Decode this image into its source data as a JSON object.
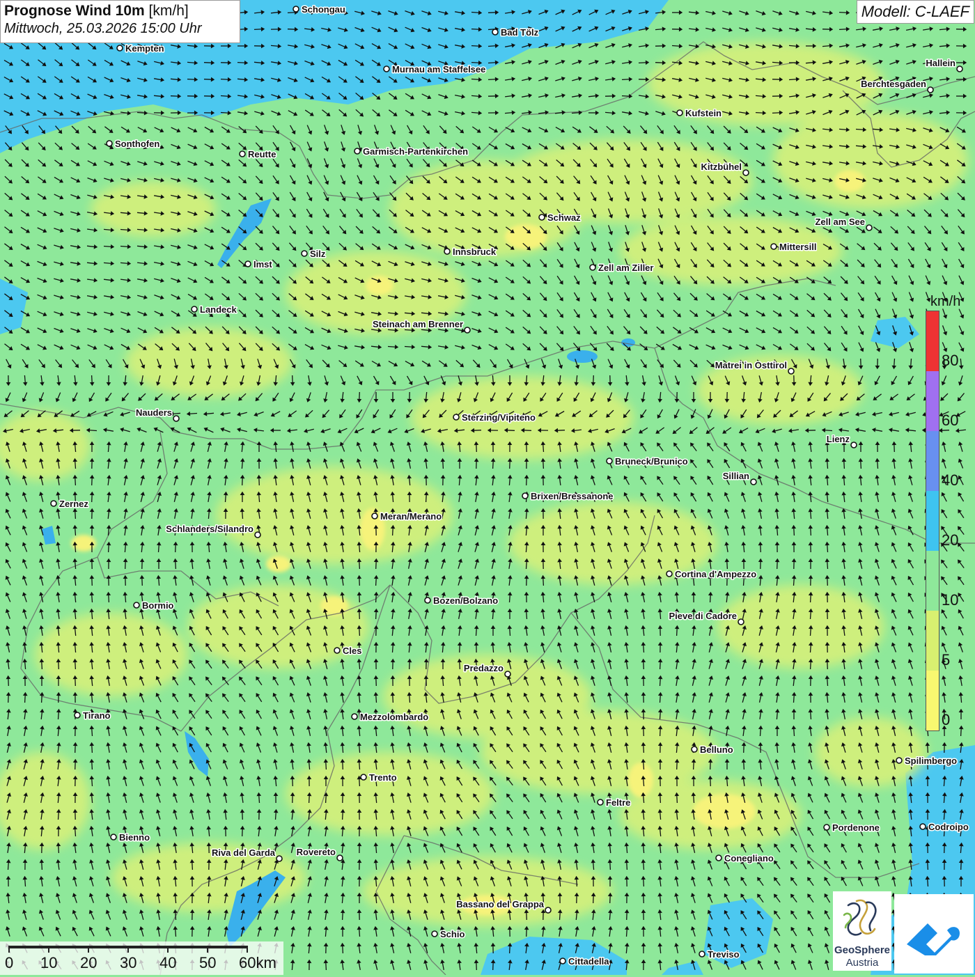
{
  "header": {
    "title_bold": "Prognose Wind 10m",
    "title_unit": "[km/h]",
    "datetime": "Mittwoch, 25.03.2026 15:00 Uhr",
    "model": "Modell: C-LAEF"
  },
  "legend": {
    "unit": "km/h",
    "classes": [
      {
        "label": "80",
        "color": "#ee3333"
      },
      {
        "label": "60",
        "color": "#a070f0"
      },
      {
        "label": "40",
        "color": "#6890f0"
      },
      {
        "label": "20",
        "color": "#3ec4f0"
      },
      {
        "label": "10",
        "color": "#8ee89a"
      },
      {
        "label": "5",
        "color": "#d8f070"
      },
      {
        "label": "0",
        "color": "#f8f870"
      }
    ]
  },
  "scale": {
    "labels": [
      "0",
      "10",
      "20",
      "30",
      "40",
      "50",
      "60km"
    ]
  },
  "branding": {
    "name_line1": "GeoSphere",
    "name_line2": "Austria"
  },
  "cities": [
    {
      "name": "Schongau"
    },
    {
      "name": "Bad Tölz"
    },
    {
      "name": "Kempten"
    },
    {
      "name": "Murnau am Staffelsee"
    },
    {
      "name": "Hallein"
    },
    {
      "name": "Berchtesgaden"
    },
    {
      "name": "Kufstein"
    },
    {
      "name": "Sonthofen"
    },
    {
      "name": "Reutte"
    },
    {
      "name": "Garmisch-Partenkirchen"
    },
    {
      "name": "Kitzbühel"
    },
    {
      "name": "Schwaz"
    },
    {
      "name": "Zell am See"
    },
    {
      "name": "Mittersill"
    },
    {
      "name": "Innsbruck"
    },
    {
      "name": "Silz"
    },
    {
      "name": "Imst"
    },
    {
      "name": "Zell am Ziller"
    },
    {
      "name": "Landeck"
    },
    {
      "name": "Steinach am Brenner"
    },
    {
      "name": "Matrei in Osttirol"
    },
    {
      "name": "Nauders"
    },
    {
      "name": "Sterzing/Vipiteno"
    },
    {
      "name": "Lienz"
    },
    {
      "name": "Bruneck/Brunico"
    },
    {
      "name": "Sillian"
    },
    {
      "name": "Brixen/Bressanone"
    },
    {
      "name": "Zernez"
    },
    {
      "name": "Meran/Merano"
    },
    {
      "name": "Schlanders/Silandro"
    },
    {
      "name": "Cortina d'Ampezzo"
    },
    {
      "name": "Bozen/Bolzano"
    },
    {
      "name": "Bormio"
    },
    {
      "name": "Pieve di Cadore"
    },
    {
      "name": "Cles"
    },
    {
      "name": "Predazzo"
    },
    {
      "name": "Tirano"
    },
    {
      "name": "Mezzolombardo"
    },
    {
      "name": "Belluno"
    },
    {
      "name": "Spilimbergo"
    },
    {
      "name": "Trento"
    },
    {
      "name": "Feltre"
    },
    {
      "name": "Pordenone"
    },
    {
      "name": "Codroipo"
    },
    {
      "name": "Bienno"
    },
    {
      "name": "Riva del Garda"
    },
    {
      "name": "Rovereto"
    },
    {
      "name": "Conegliano"
    },
    {
      "name": "Bassano del Grappa"
    },
    {
      "name": "Schio"
    },
    {
      "name": "Treviso"
    },
    {
      "name": "Cittadella"
    }
  ]
}
